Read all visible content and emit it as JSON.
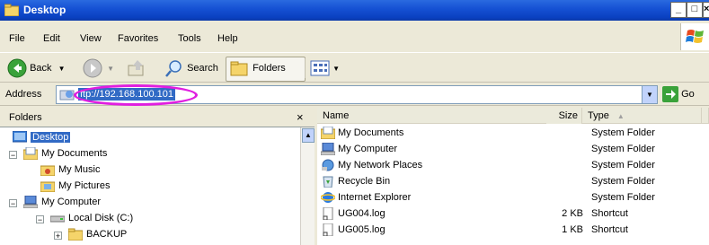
{
  "window": {
    "title": "Desktop"
  },
  "menu": [
    {
      "label": "File",
      "key": "F",
      "rest": "ile"
    },
    {
      "label": "Edit",
      "key": "E",
      "rest": "dit"
    },
    {
      "label": "View",
      "key": "V",
      "rest": "iew"
    },
    {
      "label": "Favorites",
      "key": "a",
      "pre": "F",
      "rest": "vorites"
    },
    {
      "label": "Tools",
      "key": "T",
      "rest": "ools"
    },
    {
      "label": "Help",
      "key": "H",
      "rest": "elp"
    }
  ],
  "toolbar": {
    "back": "Back",
    "search": "Search",
    "folders": "Folders"
  },
  "address": {
    "label": "Address",
    "value": "ftp://192.168.100.101",
    "go": "Go"
  },
  "folders_pane": {
    "title": "Folders",
    "close": "×",
    "tree": [
      {
        "label": "Desktop",
        "selected": true
      },
      {
        "label": "My Documents",
        "expander": "−"
      },
      {
        "label": "My Music"
      },
      {
        "label": "My Pictures"
      },
      {
        "label": "My Computer",
        "expander": "−"
      },
      {
        "label": "Local Disk (C:)",
        "expander": "−"
      },
      {
        "label": "BACKUP",
        "expander": "+"
      }
    ]
  },
  "list": {
    "columns": {
      "name": "Name",
      "size": "Size",
      "type": "Type"
    },
    "rows": [
      {
        "name": "My Documents",
        "size": "",
        "type": "System Folder"
      },
      {
        "name": "My Computer",
        "size": "",
        "type": "System Folder"
      },
      {
        "name": "My Network Places",
        "size": "",
        "type": "System Folder"
      },
      {
        "name": "Recycle Bin",
        "size": "",
        "type": "System Folder"
      },
      {
        "name": "Internet Explorer",
        "size": "",
        "type": "System Folder"
      },
      {
        "name": "UG004.log",
        "size": "2 KB",
        "type": "Shortcut"
      },
      {
        "name": "UG005.log",
        "size": "1 KB",
        "type": "Shortcut"
      }
    ]
  },
  "colors": {
    "titlebar": "#0a40c0",
    "highlight": "#e01ee0",
    "selection": "#316ac5"
  }
}
